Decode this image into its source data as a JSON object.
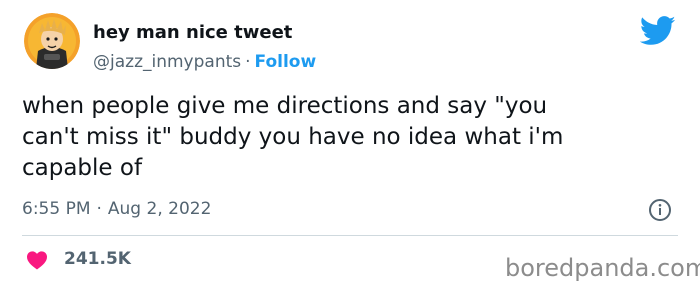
{
  "author": {
    "display_name": "hey man nice tweet",
    "handle": "@jazz_inmypants",
    "separator": "·",
    "follow_label": "Follow"
  },
  "tweet": {
    "text": "when people give me directions and say  \"you\ncan't miss it\" buddy you have no idea what i'm\ncapable of",
    "time": "6:55 PM",
    "separator": "·",
    "date": "Aug 2, 2022",
    "likes": "241.5K"
  },
  "icons": {
    "avatar": "avatar-cartoon-icon",
    "brand": "twitter-bird-icon",
    "info": "info-icon",
    "like": "heart-icon"
  },
  "colors": {
    "brand_blue": "#1d9bf0",
    "like_pink": "#f91880",
    "secondary_text": "#536471"
  },
  "watermark": "boredpanda.com"
}
